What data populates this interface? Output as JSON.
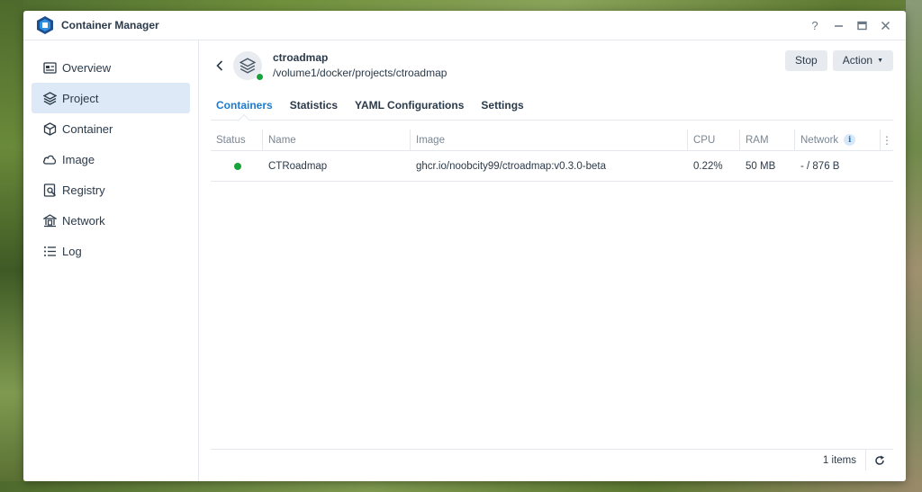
{
  "app": {
    "title": "Container Manager",
    "controls": {
      "help": "?",
      "minimize": "—",
      "maximize": "▭",
      "close": "✕"
    }
  },
  "sidebar": {
    "items": [
      {
        "label": "Overview",
        "icon": "overview-icon",
        "active": false
      },
      {
        "label": "Project",
        "icon": "project-icon",
        "active": true
      },
      {
        "label": "Container",
        "icon": "container-icon",
        "active": false
      },
      {
        "label": "Image",
        "icon": "cloud-icon",
        "active": false
      },
      {
        "label": "Registry",
        "icon": "registry-icon",
        "active": false
      },
      {
        "label": "Network",
        "icon": "network-icon",
        "active": false
      },
      {
        "label": "Log",
        "icon": "log-icon",
        "active": false
      }
    ]
  },
  "project": {
    "name": "ctroadmap",
    "path": "/volume1/docker/projects/ctroadmap",
    "status_color": "#17a33b",
    "stop_label": "Stop",
    "action_label": "Action"
  },
  "tabs": [
    {
      "label": "Containers",
      "active": true
    },
    {
      "label": "Statistics",
      "active": false
    },
    {
      "label": "YAML Configurations",
      "active": false
    },
    {
      "label": "Settings",
      "active": false
    }
  ],
  "table": {
    "columns": [
      "Status",
      "Name",
      "Image",
      "CPU",
      "RAM",
      "Network"
    ],
    "rows": [
      {
        "status": "running",
        "name": "CTRoadmap",
        "image": "ghcr.io/noobcity99/ctroadmap:v0.3.0-beta",
        "cpu": "0.22%",
        "ram": "50 MB",
        "network": "- / 876 B"
      }
    ]
  },
  "footer": {
    "count": "1 items"
  },
  "colors": {
    "accent": "#1a7bd0",
    "active_bg": "#dde9f6",
    "running": "#17a33b"
  }
}
